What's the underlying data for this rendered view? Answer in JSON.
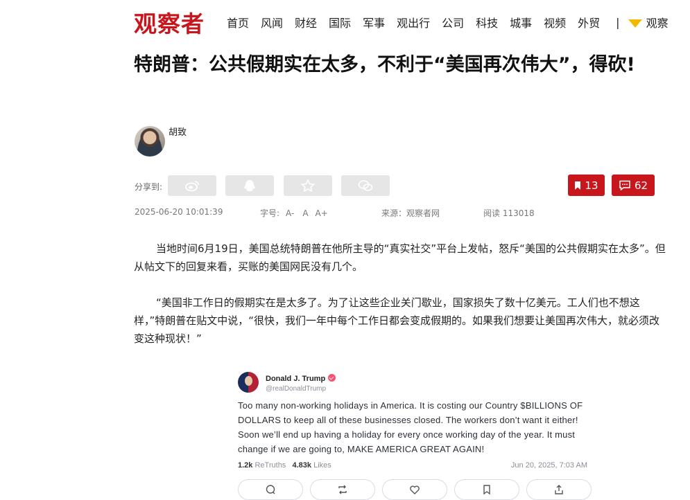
{
  "header": {
    "logo": "观察者",
    "nav": [
      "首页",
      "风闻",
      "财经",
      "国际",
      "军事",
      "观出行",
      "公司",
      "科技",
      "城事",
      "视频",
      "外贸"
    ],
    "nav_separator": "|",
    "nav_more": "观察"
  },
  "article": {
    "title": "特朗普：公共假期实在太多，不利于“美国再次伟大”，得砍!",
    "author": "胡致",
    "share_label": "分享到:",
    "share_icons": [
      "weibo-icon",
      "qq-icon",
      "qzone-icon",
      "wechat-icon"
    ],
    "bookmark_count": "13",
    "comment_count": "62",
    "meta": {
      "datetime": "2025-06-20 10:01:39",
      "font_size_label": "字号:",
      "font_sizes": [
        "A-",
        "A",
        "A+"
      ],
      "source": "来源：观察者网",
      "views": "阅读 113018"
    },
    "paragraphs": [
      "当地时间6月19日，美国总统特朗普在他所主导的“真实社交”平台上发帖，怒斥“美国的公共假期实在太多”。但从帖文下的回复来看，买账的美国网民没有几个。",
      "“美国非工作日的假期实在是太多了。为了让这些企业关门歇业，国家损失了数十亿美元。工人们也不想这样，”特朗普在贴文中说，“很快，我们一年中每个工作日都会变成假期的。如果我们想要让美国再次伟大，就必须改变这种现状！”"
    ]
  },
  "tweet": {
    "name": "Donald J. Trump",
    "handle": "@realDonaldTrump",
    "text": "Too many non-working holidays in America. It is costing our Country $BILLIONS OF DOLLARS to keep all of these businesses closed. The workers don’t want it either! Soon we’ll end up having a holiday for every once working day of the year. It must change if we are going to, MAKE AMERICA GREAT AGAIN!",
    "retruths_count": "1.2k",
    "retruths_label": "ReTruths",
    "likes_count": "4.83k",
    "likes_label": "Likes",
    "date": "Jun 20, 2025, 7:03 AM",
    "actions": [
      "reply-icon",
      "retruth-icon",
      "like-icon",
      "bookmark-icon",
      "share-icon"
    ]
  },
  "colors": {
    "brand_red": "#c8161d",
    "share_bg": "#e6e6e6",
    "verified_pink": "#ff4d6d"
  }
}
